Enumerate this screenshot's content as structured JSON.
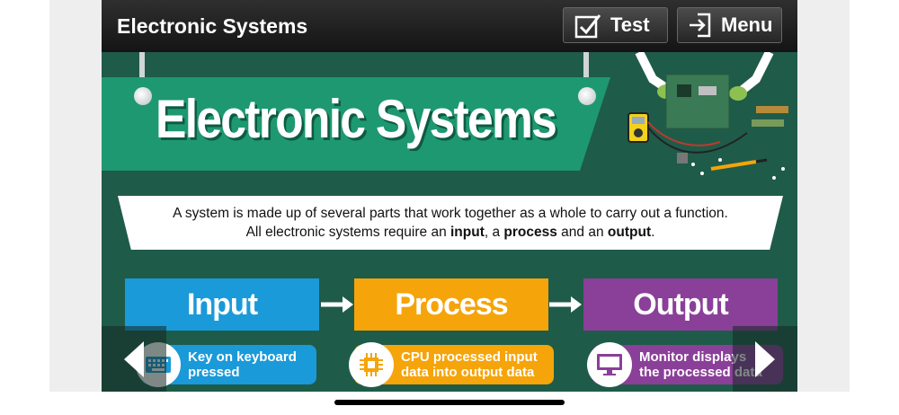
{
  "header": {
    "title": "Electronic Systems",
    "test_label": "Test",
    "menu_label": "Menu"
  },
  "banner": {
    "title": "Electronic Systems"
  },
  "description": {
    "line1": "A system is made up of several parts that work together as a whole to carry out a function.",
    "line2_prefix": "All electronic systems require an ",
    "input_word": "input",
    "sep1": ", a ",
    "process_word": "process",
    "sep2": " and an ",
    "output_word": "output",
    "line2_end": "."
  },
  "steps": [
    {
      "label": "Input",
      "color": "#1a9ad8"
    },
    {
      "label": "Process",
      "color": "#f5a40a"
    },
    {
      "label": "Output",
      "color": "#8a3f98"
    }
  ],
  "examples": [
    {
      "line1": "Key on keyboard",
      "line2": "pressed",
      "icon": "keyboard-icon",
      "color": "#1a9ad8"
    },
    {
      "line1": "CPU processed input",
      "line2": "data into output data",
      "icon": "cpu-icon",
      "color": "#f5a40a"
    },
    {
      "line1": "Monitor displays",
      "line2": "the processed data",
      "icon": "monitor-icon",
      "color": "#8a3f98"
    }
  ],
  "nav": {
    "prev_icon": "chevron-left-icon",
    "next_icon": "chevron-right-icon"
  },
  "colors": {
    "background": "#1f5b49",
    "banner": "#1e9870",
    "topbar": "#1c1c1c"
  }
}
